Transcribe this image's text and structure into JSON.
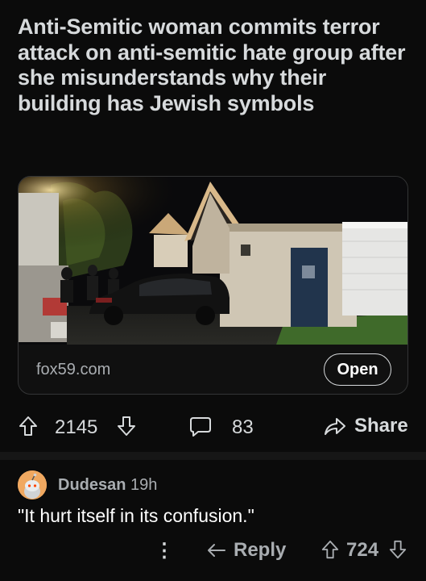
{
  "post": {
    "title": "Anti-Semitic woman commits terror attack on anti-semitic hate group after she misunderstands why their building has Jewish symbols",
    "link": {
      "domain": "fox59.com",
      "open_label": "Open"
    },
    "actions": {
      "score": "2145",
      "comments": "83",
      "share_label": "Share"
    }
  },
  "comment": {
    "username": "Dudesan",
    "age": "19h",
    "body": "\"It hurt itself in its confusion.\"",
    "more_icon": "⋮",
    "reply_label": "Reply",
    "score": "724"
  },
  "colors": {
    "background": "#0b0b0b",
    "text": "#d7dadc",
    "muted": "#a9adb1",
    "avatar": "#f0a860",
    "card_border": "#343536"
  }
}
